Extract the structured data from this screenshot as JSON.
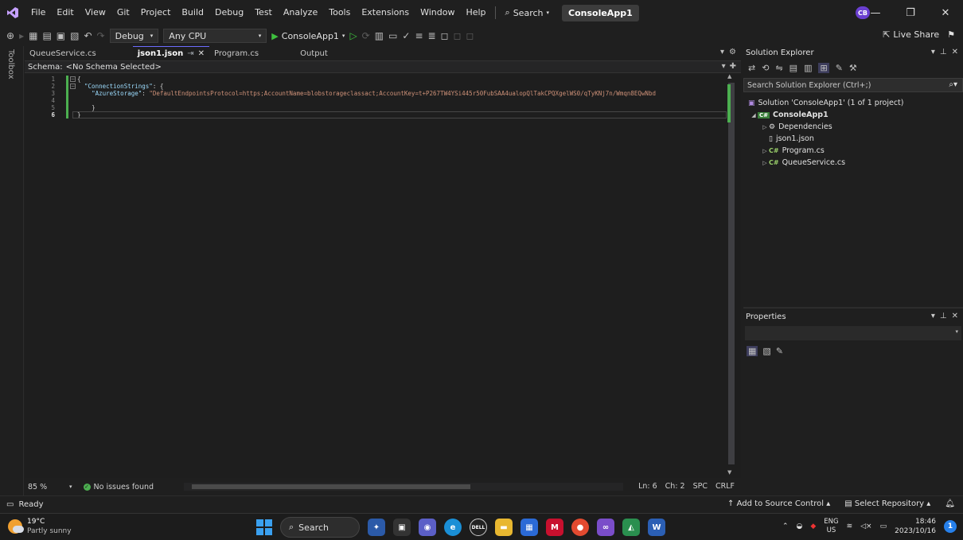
{
  "menu": {
    "items": [
      "File",
      "Edit",
      "View",
      "Git",
      "Project",
      "Build",
      "Debug",
      "Test",
      "Analyze",
      "Tools",
      "Extensions",
      "Window",
      "Help"
    ],
    "search_label": "Search",
    "app_title": "ConsoleApp1"
  },
  "user_initials": "CB",
  "toolbar": {
    "config": "Debug",
    "platform": "Any CPU",
    "run_target": "ConsoleApp1",
    "live_share": "Live Share"
  },
  "toolbox_label": "Toolbox",
  "editor": {
    "tabs": [
      {
        "label": "QueueService.cs"
      },
      {
        "label": "json1.json"
      },
      {
        "label": "Program.cs"
      },
      {
        "label": "Output"
      }
    ],
    "schema_label": "Schema:",
    "schema_value": "<No Schema Selected>",
    "line_numbers": [
      "1",
      "2",
      "3",
      "4",
      "5",
      "6"
    ],
    "code": {
      "l1": "{",
      "l2_key": "\"ConnectionStrings\"",
      "l2_rest": ": {",
      "l3_key": "\"AzureStorage\"",
      "l3_sep": ": ",
      "l3_value": "\"DefaultEndpointsProtocol=https;AccountName=blobstorageclassact;AccountKey=t+P267TW4YSi445r50FubSAA4ualopQlTakCPQXgelWS0/qTyKNj7n/Wmqn8EQwNbd",
      "l5": "}",
      "l6": "}"
    },
    "zoom": "85 %",
    "issues": "No issues found",
    "position": {
      "ln": "Ln: 6",
      "ch": "Ch: 2",
      "spc": "SPC",
      "crlf": "CRLF"
    }
  },
  "solution_explorer": {
    "title": "Solution Explorer",
    "search_placeholder": "Search Solution Explorer (Ctrl+;)",
    "tree": {
      "solution": "Solution 'ConsoleApp1' (1 of 1 project)",
      "project": "ConsoleApp1",
      "dependencies": "Dependencies",
      "json": "json1.json",
      "program": "Program.cs",
      "queue": "QueueService.cs"
    }
  },
  "properties": {
    "title": "Properties"
  },
  "statusbar": {
    "ready": "Ready",
    "add_source_control": "Add to Source Control",
    "select_repository": "Select Repository"
  },
  "taskbar": {
    "weather_temp": "19°C",
    "weather_desc": "Partly sunny",
    "search_label": "Search",
    "lang_top": "ENG",
    "lang_bottom": "US",
    "time": "18:46",
    "date": "2023/10/16",
    "notification_count": "1"
  },
  "colors": {
    "accent": "#6c6cff",
    "change_marker": "#4caf50",
    "json_key": "#9cdcfe",
    "json_string": "#ce9178"
  }
}
